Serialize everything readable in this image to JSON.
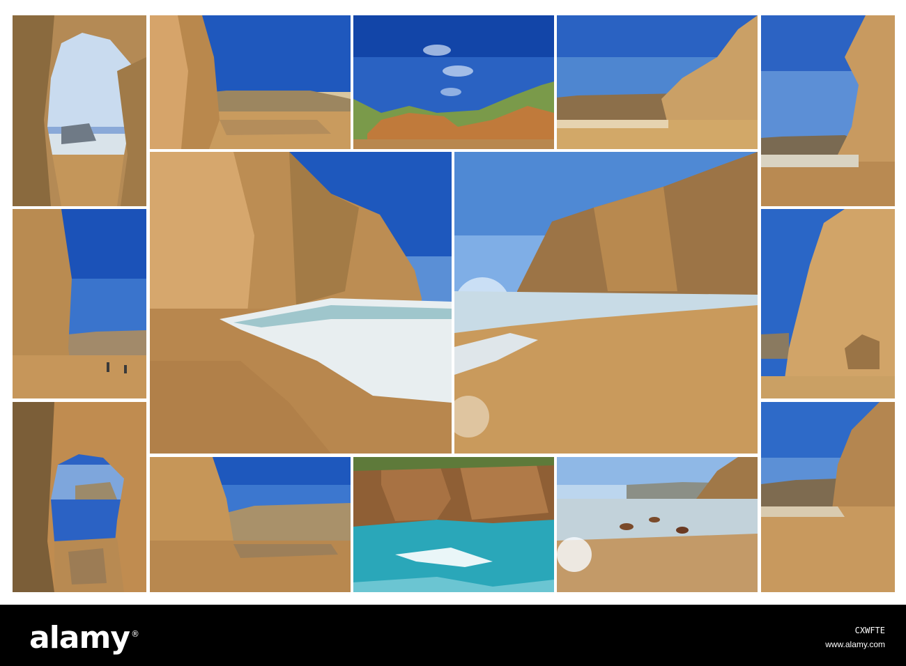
{
  "footer": {
    "brand": "alamy",
    "image_id": "CXWFTE",
    "url": "www.alamy.com"
  },
  "colors": {
    "sky": "#1c4fb0",
    "sky_light": "#5f98d8",
    "sand": "#c89452",
    "cliff": "#c08a4e",
    "sea": "#2ea6b8"
  },
  "tiles": [
    "arch-cave-sea-view",
    "cliff-and-headland-reflection",
    "green-hill-cliffs-blue-sky",
    "cliff-wall-long-beach",
    "tall-cliff-right-beach",
    "cliff-beach-people-walking",
    "cliff-rock-arch-right",
    "large-cliff-beach-surf",
    "large-sunlit-cliff-beach",
    "arch-cave-beach-reflection",
    "cliff-beach-headland-reflection",
    "turquoise-sea-cliffs",
    "sunlit-sea-rocks",
    "tall-cliff-beach-sunset"
  ]
}
